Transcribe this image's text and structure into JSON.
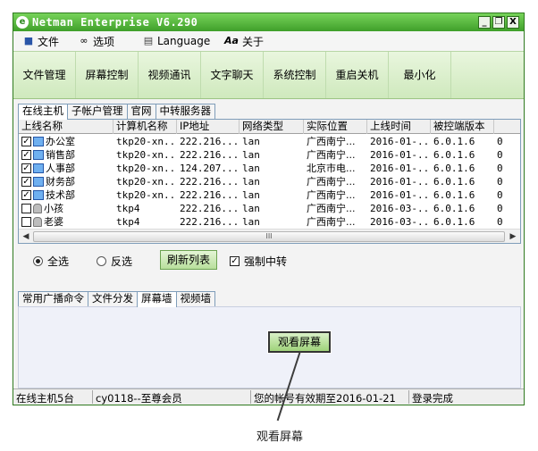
{
  "window": {
    "title": "Netman Enterprise V6.290",
    "logo": "e"
  },
  "window_controls": {
    "minimize": "_",
    "restore": "❐",
    "close": "X"
  },
  "menu": [
    {
      "label": "文件",
      "icon": "disk-icon",
      "glyph": "■"
    },
    {
      "label": "选项",
      "icon": "glasses-icon",
      "glyph": "∞"
    },
    {
      "label": "Language",
      "icon": "language-icon",
      "glyph": "▤"
    },
    {
      "label": "关于",
      "icon": "font-icon",
      "glyph": "Aa"
    }
  ],
  "toolbar": [
    "文件管理",
    "屏幕控制",
    "视频通讯",
    "文字聊天",
    "系统控制",
    "重启关机",
    "最小化"
  ],
  "main_tabs": [
    "在线主机",
    "子帐户管理",
    "官网",
    "中转服务器"
  ],
  "table": {
    "columns": [
      "上线名称",
      "计算机名称",
      "IP地址",
      "网络类型",
      "实际位置",
      "上线时间",
      "被控端版本",
      ""
    ],
    "rows": [
      {
        "checked": true,
        "online": true,
        "name": "办公室",
        "computer": "tkp20-xn...",
        "ip": "222.216...",
        "net": "lan",
        "loc": "广西南宁...",
        "time": "2016-01-...",
        "ver": "6.0.1.6",
        "extra": "0"
      },
      {
        "checked": true,
        "online": true,
        "name": "销售部",
        "computer": "tkp20-xn...",
        "ip": "222.216...",
        "net": "lan",
        "loc": "广西南宁...",
        "time": "2016-01-...",
        "ver": "6.0.1.6",
        "extra": "0"
      },
      {
        "checked": true,
        "online": true,
        "name": "人事部",
        "computer": "tkp20-xn...",
        "ip": "124.207...",
        "net": "lan",
        "loc": "北京市电...",
        "time": "2016-01-...",
        "ver": "6.0.1.6",
        "extra": "0"
      },
      {
        "checked": true,
        "online": true,
        "name": "财务部",
        "computer": "tkp20-xn...",
        "ip": "222.216...",
        "net": "lan",
        "loc": "广西南宁...",
        "time": "2016-01-...",
        "ver": "6.0.1.6",
        "extra": "0"
      },
      {
        "checked": true,
        "online": true,
        "name": "技术部",
        "computer": "tkp20-xn...",
        "ip": "222.216...",
        "net": "lan",
        "loc": "广西南宁...",
        "time": "2016-01-...",
        "ver": "6.0.1.6",
        "extra": "0"
      },
      {
        "checked": false,
        "online": false,
        "name": "小孩",
        "computer": "tkp4",
        "ip": "222.216...",
        "net": "lan",
        "loc": "广西南宁...",
        "time": "2016-03-...",
        "ver": "6.0.1.6",
        "extra": "0"
      },
      {
        "checked": false,
        "online": false,
        "name": "老婆",
        "computer": "tkp4",
        "ip": "222.216...",
        "net": "lan",
        "loc": "广西南宁...",
        "time": "2016-03-...",
        "ver": "6.0.1.6",
        "extra": "0"
      }
    ],
    "scroll_grip": "III"
  },
  "selection": {
    "select_all": "全选",
    "invert": "反选",
    "refresh": "刷新列表",
    "force_relay": "强制中转",
    "select_all_checked": true,
    "force_relay_checked": true
  },
  "sub_tabs": [
    "常用广播命令",
    "文件分发",
    "屏幕墙",
    "视频墙"
  ],
  "screen_wall": {
    "view_button": "观看屏幕"
  },
  "status": {
    "hosts": "在线主机5台",
    "member": "cy0118--至尊会员",
    "expiry": "您的帐号有效期至2016-01-21",
    "login": "登录完成"
  },
  "callout": "观看屏幕",
  "colors": {
    "titlebar": "#3f9f2a",
    "toolbar": "#cfe9bd",
    "panel": "#eff1f9"
  }
}
